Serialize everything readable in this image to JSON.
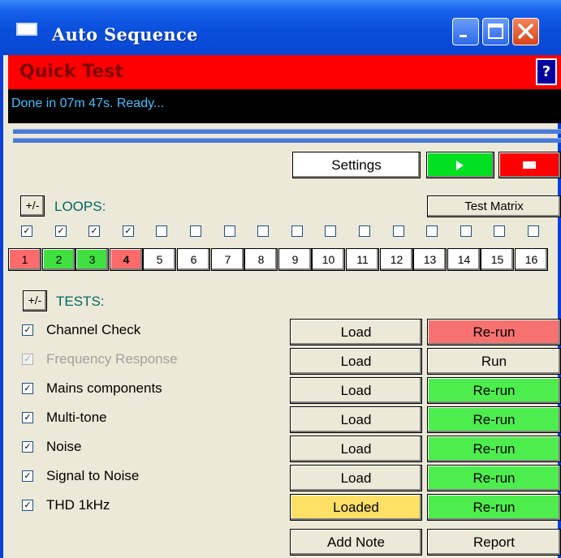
{
  "window": {
    "title": "Auto Sequence"
  },
  "header": {
    "title": "Quick Test",
    "help_label": "?"
  },
  "status": {
    "text": "Done in 07m 47s. Ready..."
  },
  "toolbar": {
    "settings_label": "Settings"
  },
  "loops": {
    "pm_label": "+/-",
    "label": "LOOPS:",
    "matrix_label": "Test Matrix",
    "items": [
      {
        "num": "1",
        "checked": true,
        "color": "#ff6b6b"
      },
      {
        "num": "2",
        "checked": true,
        "color": "#40e040"
      },
      {
        "num": "3",
        "checked": true,
        "color": "#40e040"
      },
      {
        "num": "4",
        "checked": true,
        "color": "#ff6b6b"
      },
      {
        "num": "5",
        "checked": false,
        "color": "#ffffff"
      },
      {
        "num": "6",
        "checked": false,
        "color": "#ffffff"
      },
      {
        "num": "7",
        "checked": false,
        "color": "#ffffff"
      },
      {
        "num": "8",
        "checked": false,
        "color": "#ffffff"
      },
      {
        "num": "9",
        "checked": false,
        "color": "#ffffff"
      },
      {
        "num": "10",
        "checked": false,
        "color": "#ffffff"
      },
      {
        "num": "11",
        "checked": false,
        "color": "#ffffff"
      },
      {
        "num": "12",
        "checked": false,
        "color": "#ffffff"
      },
      {
        "num": "13",
        "checked": false,
        "color": "#ffffff"
      },
      {
        "num": "14",
        "checked": false,
        "color": "#ffffff"
      },
      {
        "num": "15",
        "checked": false,
        "color": "#ffffff"
      },
      {
        "num": "16",
        "checked": false,
        "color": "#ffffff"
      }
    ]
  },
  "tests": {
    "pm_label": "+/-",
    "label": "TESTS:",
    "items": [
      {
        "name": "Channel Check",
        "checked": true,
        "enabled": true,
        "load": "Load",
        "load_color": "#ece9d8",
        "run": "Re-run",
        "run_color": "#f77171"
      },
      {
        "name": "Frequency Response",
        "checked": true,
        "enabled": false,
        "load": "Load",
        "load_color": "#ece9d8",
        "run": "Run",
        "run_color": "#ece9d8"
      },
      {
        "name": "Mains components",
        "checked": true,
        "enabled": true,
        "load": "Load",
        "load_color": "#ece9d8",
        "run": "Re-run",
        "run_color": "#4ded4d"
      },
      {
        "name": "Multi-tone",
        "checked": true,
        "enabled": true,
        "load": "Load",
        "load_color": "#ece9d8",
        "run": "Re-run",
        "run_color": "#4ded4d"
      },
      {
        "name": "Noise",
        "checked": true,
        "enabled": true,
        "load": "Load",
        "load_color": "#ece9d8",
        "run": "Re-run",
        "run_color": "#4ded4d"
      },
      {
        "name": "Signal to Noise",
        "checked": true,
        "enabled": true,
        "load": "Load",
        "load_color": "#ece9d8",
        "run": "Re-run",
        "run_color": "#4ded4d"
      },
      {
        "name": "THD 1kHz",
        "checked": true,
        "enabled": true,
        "load": "Loaded",
        "load_color": "#ffe066",
        "run": "Re-run",
        "run_color": "#4ded4d"
      }
    ]
  },
  "footer": {
    "add_note_label": "Add Note",
    "report_label": "Report"
  }
}
